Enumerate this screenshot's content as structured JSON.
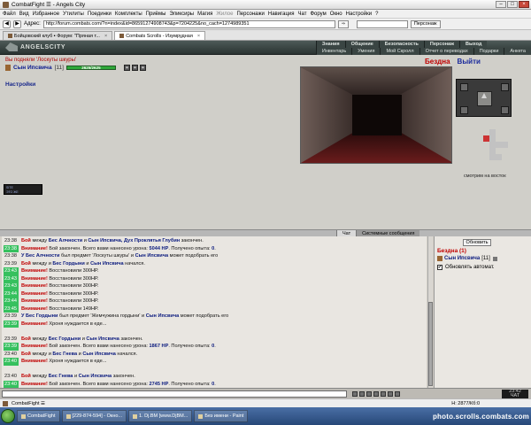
{
  "window": {
    "title": "CombatFight ☰ - Angels City"
  },
  "menubar": [
    {
      "label": "Файл",
      "dim": false
    },
    {
      "label": "Вид",
      "dim": false
    },
    {
      "label": "Избранное",
      "dim": false
    },
    {
      "label": "Утилиты",
      "dim": false
    },
    {
      "label": "Поединки",
      "dim": false
    },
    {
      "label": "Комплекты",
      "dim": false
    },
    {
      "label": "Приёмы",
      "dim": false
    },
    {
      "label": "Эликсиры",
      "dim": false
    },
    {
      "label": "Магия",
      "dim": false
    },
    {
      "label": "Жилое",
      "dim": true
    },
    {
      "label": "Персонажи",
      "dim": false
    },
    {
      "label": "Навигация",
      "dim": false
    },
    {
      "label": "Чат",
      "dim": false
    },
    {
      "label": "Форум",
      "dim": false
    },
    {
      "label": "Окно",
      "dim": false
    },
    {
      "label": "Настройки",
      "dim": false
    },
    {
      "label": "?",
      "dim": false
    }
  ],
  "address": {
    "label": "Адрес:",
    "value": "http://forum.combats.com/?n=index&id=86591274908743&p=7204225&no_cach=1274989351",
    "go_label": "⇒",
    "search_label": "Персонаж",
    "search_placeholder": ""
  },
  "tabs": [
    {
      "label": "Бойцовский клуб ▪ Форум: \"Пряная т...",
      "active": false
    },
    {
      "label": "Combats Scrolls - Изумрудная",
      "active": true
    }
  ],
  "header": {
    "logo": "ANGELSCITY",
    "nav_top": [
      "Знания",
      "Общение",
      "Безопасность",
      "Персонаж",
      "Выход"
    ],
    "nav_bottom": [
      "Инвентарь",
      "Умения",
      "Мой Скролл",
      "Отчет о переводах",
      "Подарки",
      "Анкета"
    ]
  },
  "game": {
    "pickup_msg": "Вы подняли 'Лоскуты шкуры'",
    "char_name": "Сын Ипсвича",
    "char_level": "[11]",
    "hp_text": "2625/2625",
    "hp_fraction": 1,
    "settings": "Настройки",
    "location": "Бездна",
    "exit_label": "Выйти",
    "facing": "смотрим на восток",
    "ad_line1": "SITE",
    "ad_line2": "ЭТО ЖЕ"
  },
  "chat": {
    "tabs": [
      "Чат",
      "Системные сообщения"
    ],
    "lines": [
      {
        "t": "23:38",
        "g": false,
        "parts": [
          [
            "n",
            "Бой"
          ],
          [
            "t",
            " между "
          ],
          [
            "e",
            "Бес Алчности"
          ],
          [
            "t",
            " и "
          ],
          [
            "p",
            "Сын Ипсвича, Дух Проклятья Глубин"
          ],
          [
            "t",
            " закончен."
          ]
        ]
      },
      {
        "t": "23:38",
        "g": true,
        "parts": [
          [
            "w",
            "Внимание!"
          ],
          [
            "t",
            " Бой закончен. Всего вами нанесено урона: "
          ],
          [
            "p",
            "5044 HP"
          ],
          [
            "t",
            ". Получено опыта: "
          ],
          [
            "p",
            "0"
          ],
          [
            "t",
            "."
          ]
        ]
      },
      {
        "t": "23:38",
        "g": false,
        "parts": [
          [
            "e",
            "У Бес Алчности"
          ],
          [
            "t",
            " был предмет 'Лоскуты шкуры' и "
          ],
          [
            "p",
            "Сын Ипсвича"
          ],
          [
            "t",
            " может подобрать его"
          ]
        ]
      },
      {
        "t": "23:39",
        "g": false,
        "parts": [
          [
            "n",
            "Бой"
          ],
          [
            "t",
            " между и "
          ],
          [
            "e",
            "Бес Гордыни"
          ],
          [
            "t",
            " и "
          ],
          [
            "p",
            "Сын Ипсвича"
          ],
          [
            "t",
            " начался."
          ]
        ]
      },
      {
        "t": "23:43",
        "g": true,
        "parts": [
          [
            "w",
            "Внимание!"
          ],
          [
            "t",
            " Восстановили 300HP."
          ]
        ]
      },
      {
        "t": "23:43",
        "g": true,
        "parts": [
          [
            "w",
            "Внимание!"
          ],
          [
            "t",
            " Восстановили 300HP."
          ]
        ]
      },
      {
        "t": "23:43",
        "g": true,
        "parts": [
          [
            "w",
            "Внимание!"
          ],
          [
            "t",
            " Восстановили 300HP."
          ]
        ]
      },
      {
        "t": "23:44",
        "g": true,
        "parts": [
          [
            "w",
            "Внимание!"
          ],
          [
            "t",
            " Восстановили 300HP."
          ]
        ]
      },
      {
        "t": "23:44",
        "g": true,
        "parts": [
          [
            "w",
            "Внимание!"
          ],
          [
            "t",
            " Восстановили 300HP."
          ]
        ]
      },
      {
        "t": "23:45",
        "g": true,
        "parts": [
          [
            "w",
            "Внимание!"
          ],
          [
            "t",
            " Восстановили 149HP."
          ]
        ]
      },
      {
        "t": "23:39",
        "g": false,
        "parts": [
          [
            "e",
            "У Бес Гордыни"
          ],
          [
            "t",
            " был предмет 'Жемчужина гордыни' и "
          ],
          [
            "p",
            "Сын Ипсвича"
          ],
          [
            "t",
            " может подобрать его"
          ]
        ]
      },
      {
        "t": "23:39",
        "g": true,
        "parts": [
          [
            "w",
            "Внимание!"
          ],
          [
            "t",
            " Хроня нуждается в еде..."
          ]
        ]
      },
      {
        "t": "",
        "g": false,
        "parts": [
          [
            "t",
            " "
          ]
        ]
      },
      {
        "t": "23:39",
        "g": false,
        "parts": [
          [
            "n",
            "Бой"
          ],
          [
            "t",
            " между "
          ],
          [
            "e",
            "Бес Гордыни"
          ],
          [
            "t",
            " и "
          ],
          [
            "p",
            "Сын Ипсвича"
          ],
          [
            "t",
            " закончен."
          ]
        ]
      },
      {
        "t": "23:39",
        "g": true,
        "parts": [
          [
            "w",
            "Внимание!"
          ],
          [
            "t",
            " Бой закончен. Всего вами нанесено урона: "
          ],
          [
            "p",
            "1867 HP"
          ],
          [
            "t",
            ". Получено опыта: "
          ],
          [
            "p",
            "0"
          ],
          [
            "t",
            "."
          ]
        ]
      },
      {
        "t": "23:40",
        "g": false,
        "parts": [
          [
            "n",
            "Бой"
          ],
          [
            "t",
            " между и "
          ],
          [
            "e",
            "Бес Гнева"
          ],
          [
            "t",
            " и "
          ],
          [
            "p",
            "Сын Ипсвича"
          ],
          [
            "t",
            " начался."
          ]
        ]
      },
      {
        "t": "23:40",
        "g": true,
        "parts": [
          [
            "w",
            "Внимание!"
          ],
          [
            "t",
            " Хроня нуждается в еде..."
          ]
        ]
      },
      {
        "t": "",
        "g": false,
        "parts": [
          [
            "t",
            " "
          ]
        ]
      },
      {
        "t": "23:40",
        "g": false,
        "parts": [
          [
            "n",
            "Бой"
          ],
          [
            "t",
            " между "
          ],
          [
            "e",
            "Бес Гнева"
          ],
          [
            "t",
            " и "
          ],
          [
            "p",
            "Сын Ипсвича"
          ],
          [
            "t",
            " закончен."
          ]
        ]
      },
      {
        "t": "23:40",
        "g": true,
        "parts": [
          [
            "w",
            "Внимание!"
          ],
          [
            "t",
            " Бой закончен. Всего вами нанесено урона: "
          ],
          [
            "p",
            "2745 HP"
          ],
          [
            "t",
            ". Получено опыта: "
          ],
          [
            "p",
            "0"
          ],
          [
            "t",
            "."
          ]
        ]
      },
      {
        "t": "23:40",
        "g": false,
        "parts": [
          [
            "e",
            "У Бес Гнева"
          ],
          [
            "t",
            " был предмет 'Жемчужина гнева' и "
          ],
          [
            "p",
            "Сын Ипсвича"
          ],
          [
            "t",
            " может подобрать его"
          ]
        ]
      },
      {
        "t": "23:41",
        "g": false,
        "parts": [
          [
            "p",
            "Сын Ипсвича"
          ],
          [
            "t",
            " поднял предмет 'Жемчужина гордыни'"
          ]
        ]
      },
      {
        "t": "23:41",
        "g": false,
        "parts": [
          [
            "p",
            "Сын Ипсвича"
          ],
          [
            "t",
            " поднял предмет 'Лоскуты шкуры'"
          ]
        ]
      },
      {
        "t": "23:41",
        "g": true,
        "parts": [
          [
            "w",
            "Внимание!"
          ],
          [
            "t",
            " Восстановили 300HP."
          ]
        ]
      }
    ]
  },
  "right_panel": {
    "refresh": "Обновить",
    "location_title": "Бездна (1)",
    "player": "Сын Ипсвича",
    "player_level": "[11]",
    "auto_update": "Обновлять автомат.",
    "auto_checked": "✔"
  },
  "clock": {
    "time": "23:42",
    "sub": "ЧАТ"
  },
  "statusbar": {
    "title": "CombatFight ☰",
    "right": "Н: 2877/Кб:0"
  },
  "taskbar": {
    "items": [
      "CombatFight",
      "[229-874-594] - Окно...",
      "1. Dj.BM [www.DjBM...",
      "Без имени - Paint"
    ],
    "watermark": "photo.scrolls.combats.com"
  }
}
